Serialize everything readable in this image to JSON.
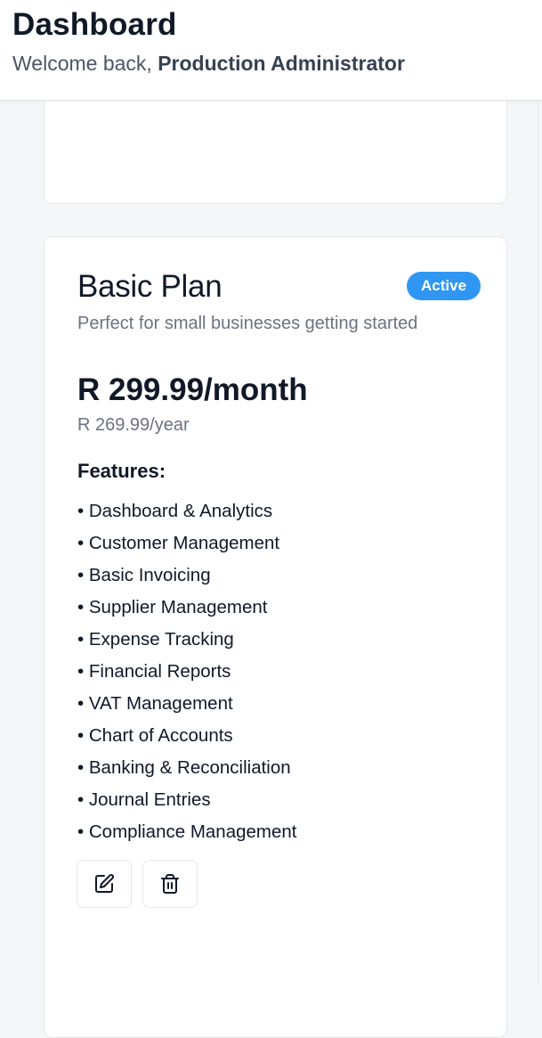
{
  "header": {
    "title": "Dashboard",
    "welcome_prefix": "Welcome back,",
    "user_name": "Production Administrator"
  },
  "plan": {
    "name": "Basic Plan",
    "status": "Active",
    "status_color": "#2f97f3",
    "description": "Perfect for small businesses getting started",
    "price_monthly": "R 299.99/month",
    "price_yearly": "R 269.99/year",
    "features_heading": "Features:",
    "features": [
      "Dashboard & Analytics",
      "Customer Management",
      "Basic Invoicing",
      "Supplier Management",
      "Expense Tracking",
      "Financial Reports",
      "VAT Management",
      "Chart of Accounts",
      "Banking & Reconciliation",
      "Journal Entries",
      "Compliance Management"
    ],
    "actions": [
      {
        "name": "edit",
        "icon": "edit-icon"
      },
      {
        "name": "delete",
        "icon": "trash-icon"
      }
    ]
  }
}
